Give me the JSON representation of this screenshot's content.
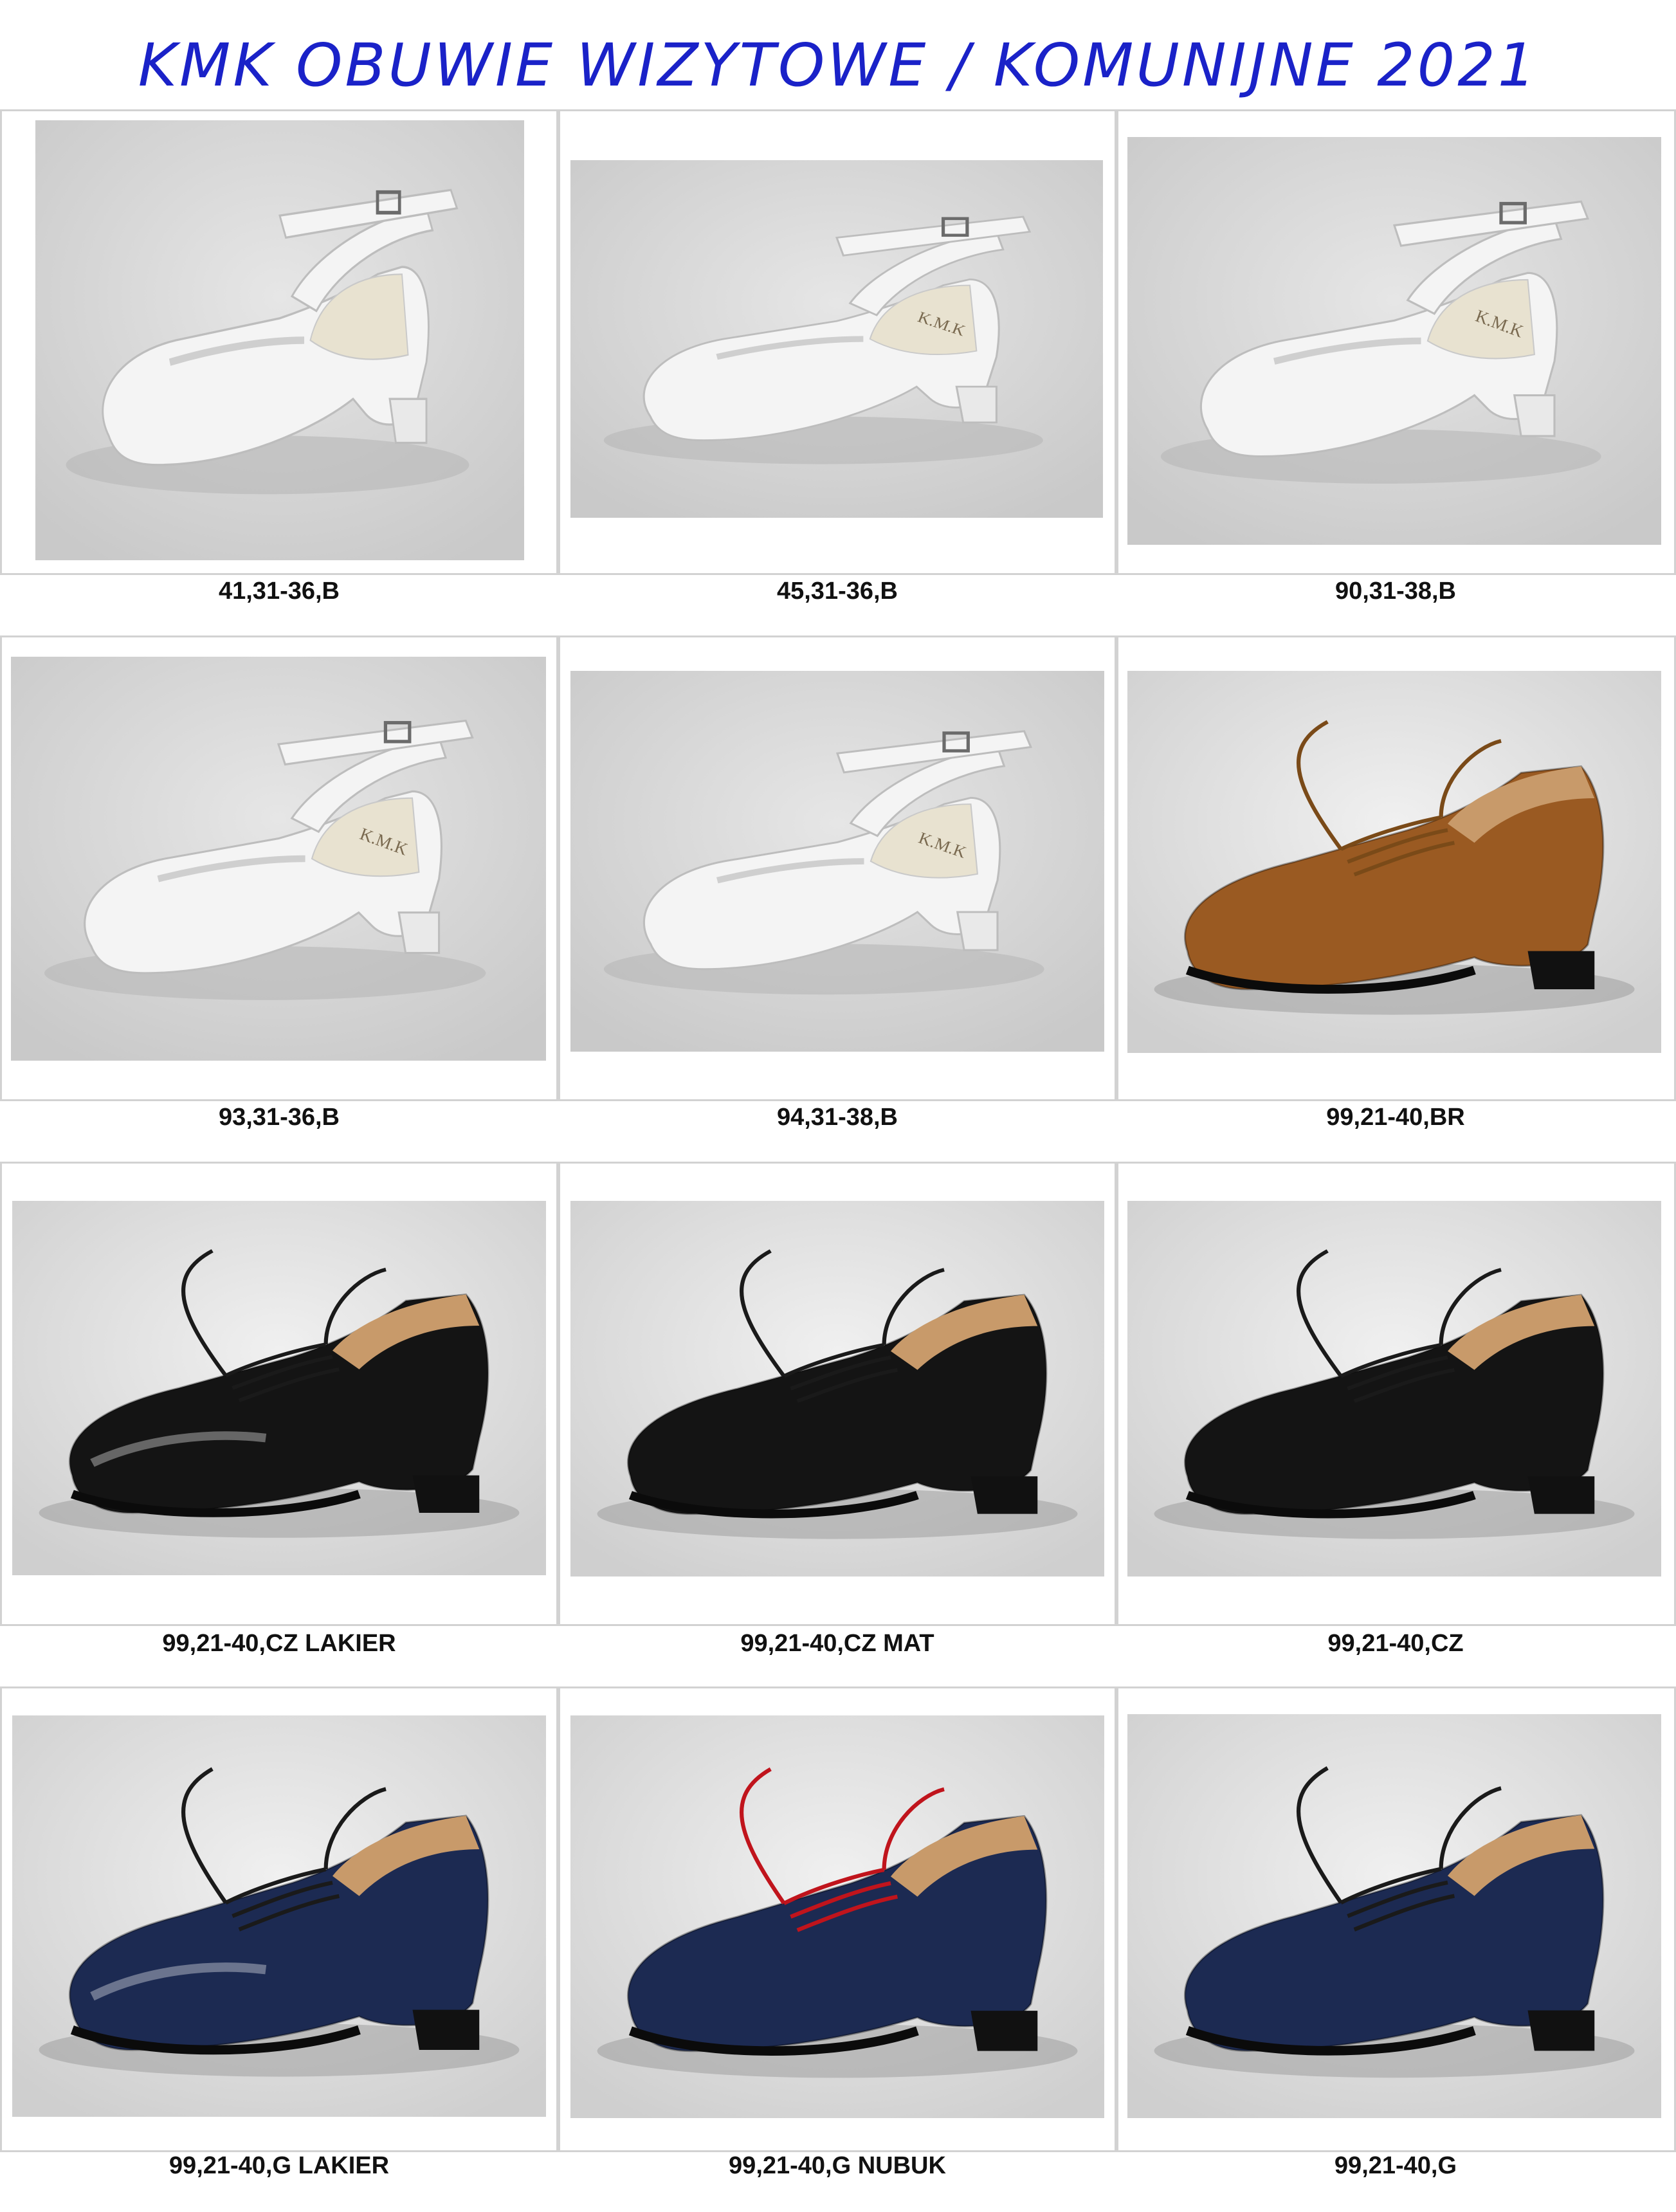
{
  "header": {
    "title": "KMK OBUWIE WIZYTOWE / KOMUNIJNE 2021"
  },
  "products": [
    {
      "code": "41,31-36,B",
      "color": "white",
      "kind": "sandal",
      "logo": ""
    },
    {
      "code": "45,31-36,B",
      "color": "white",
      "kind": "sandal",
      "logo": "K.M.K"
    },
    {
      "code": "90,31-38,B",
      "color": "white",
      "kind": "sandal",
      "logo": "K.M.K"
    },
    {
      "code": "93,31-36,B",
      "color": "white",
      "kind": "sandal",
      "logo": "K.M.K"
    },
    {
      "code": "94,31-38,B",
      "color": "white",
      "kind": "sandal",
      "logo": "K.M.K"
    },
    {
      "code": "99,21-40,BR",
      "color": "brown",
      "kind": "oxford",
      "logo": ""
    },
    {
      "code": "99,21-40,CZ LAKIER",
      "color": "black-patent",
      "kind": "oxford",
      "logo": ""
    },
    {
      "code": "99,21-40,CZ MAT",
      "color": "black",
      "kind": "oxford",
      "logo": ""
    },
    {
      "code": "99,21-40,CZ",
      "color": "black",
      "kind": "oxford",
      "logo": ""
    },
    {
      "code": "99,21-40,G LAKIER",
      "color": "navy-patent",
      "kind": "oxford",
      "logo": ""
    },
    {
      "code": "99,21-40,G NUBUK",
      "color": "navy-nubuck",
      "kind": "oxford",
      "logo": ""
    },
    {
      "code": "99,21-40,G",
      "color": "navy",
      "kind": "oxford",
      "logo": ""
    }
  ],
  "colors": {
    "title": "#1a22c8",
    "photo_bg": "#d9d9d9",
    "white_shoe": "#f4f4f4",
    "brown_shoe": "#9a5a22",
    "black_shoe": "#141414",
    "navy_shoe": "#1c2a52",
    "red_lace": "#c0141c",
    "lining": "#c89a6a"
  }
}
